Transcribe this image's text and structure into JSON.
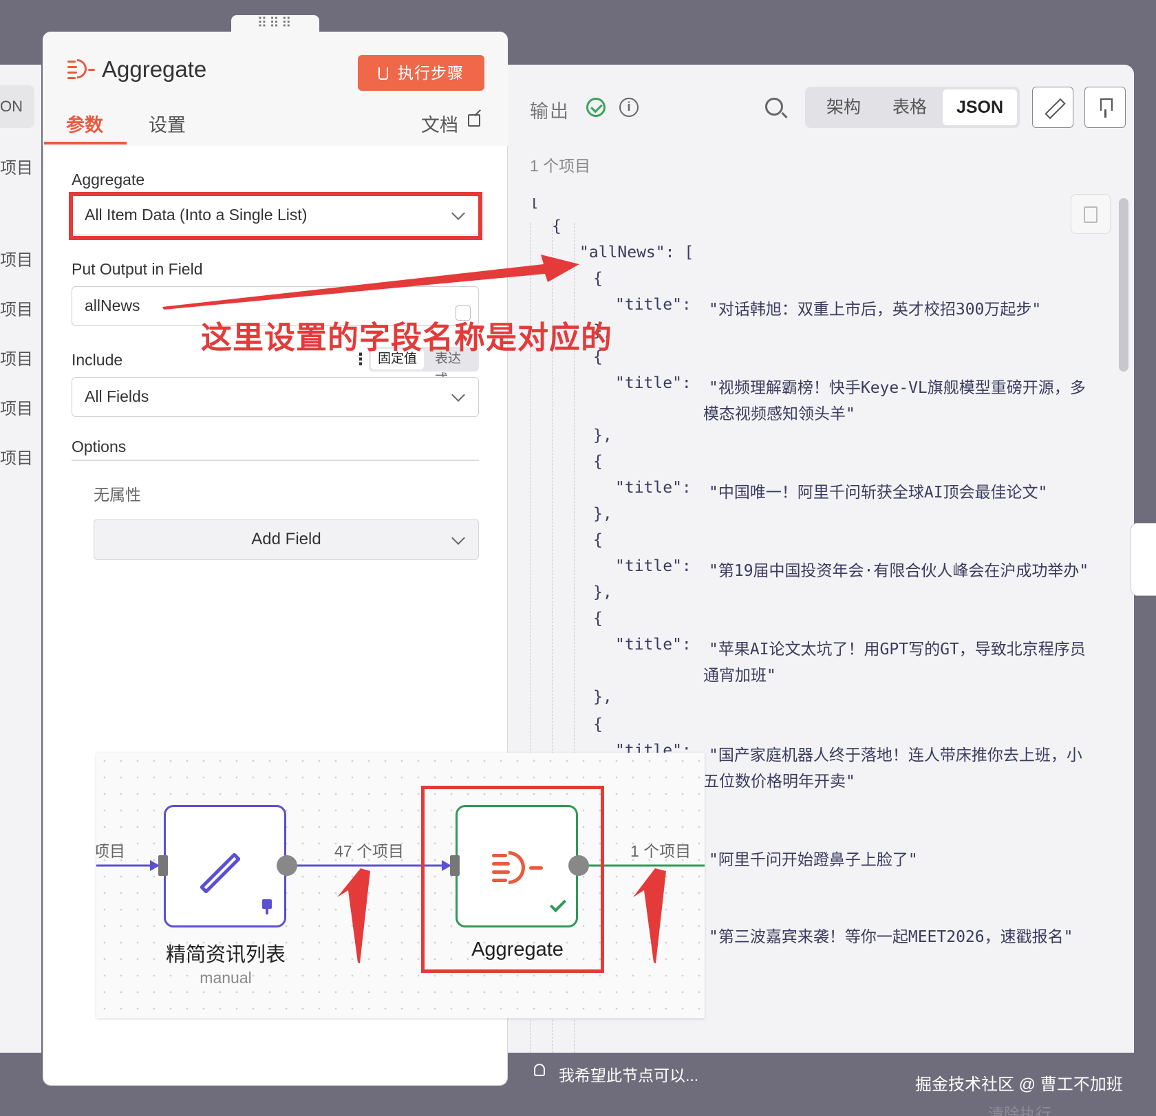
{
  "left_strip": {
    "tab": "ON",
    "items": [
      "项目",
      "项目",
      "项目",
      "项目",
      "项目",
      "项目"
    ]
  },
  "panel": {
    "drag_handle": "⠿⠿⠿",
    "title": "Aggregate",
    "execute_button": "执行步骤",
    "tabs": {
      "params": "参数",
      "settings": "设置",
      "docs": "文档"
    },
    "fields": {
      "aggregate_label": "Aggregate",
      "aggregate_value": "All Item Data (Into a Single List)",
      "output_field_label": "Put Output in Field",
      "output_field_value": "allNews",
      "include_label": "Include",
      "include_mode_fixed": "固定值",
      "include_mode_expression": "表达式",
      "include_value": "All Fields",
      "options_label": "Options",
      "no_props": "无属性",
      "add_field": "Add Field"
    }
  },
  "annotation": "这里设置的字段名称是对应的",
  "output": {
    "label": "输出",
    "views": [
      "架构",
      "表格",
      "JSON"
    ],
    "active_view": "JSON",
    "item_count": "1 个项目"
  },
  "json_view": {
    "open_bracket": "[",
    "open_brace": "{",
    "key_line": "\"allNews\": [",
    "brace_open": "{",
    "brace_close": "},",
    "key_title": "\"title\":",
    "titles": [
      [
        "\"对话韩旭：双重上市后，英才校招300万起步\""
      ],
      [
        "\"视频理解霸榜！快手Keye-VL旗舰模型重磅开源，多",
        "模态视频感知领头羊\""
      ],
      [
        "\"中国唯一！阿里千问斩获全球AI顶会最佳论文\""
      ],
      [
        "\"第19届中国投资年会·有限合伙人峰会在沪成功举办\""
      ],
      [
        "\"苹果AI论文太坑了！用GPT写的GT，导致北京程序员",
        "通宵加班\""
      ],
      [
        "\"国产家庭机器人终于落地！连人带床推你去上班，小",
        "五位数价格明年开卖\""
      ],
      [
        "\"阿里千问开始蹬鼻子上脸了\""
      ],
      [
        "\"第三波嘉宾来袭！等你一起MEET2026，速戳报名\""
      ]
    ]
  },
  "workflow": {
    "left_edge_label": "项目",
    "node1_name": "精简资讯列表",
    "node1_sub": "manual",
    "edge1_label": "47 个项目",
    "node2_name": "Aggregate",
    "edge2_label": "1 个项目"
  },
  "bottom": {
    "hint": "我希望此节点可以...",
    "credit": "掘金技术社区 @ 曹工不加班",
    "clear_exec": "清除执行"
  },
  "colors": {
    "accent": "#ea5a3d",
    "annotation": "#e53a3a",
    "success": "#2f9a55",
    "node_purple": "#5b4fd4"
  }
}
